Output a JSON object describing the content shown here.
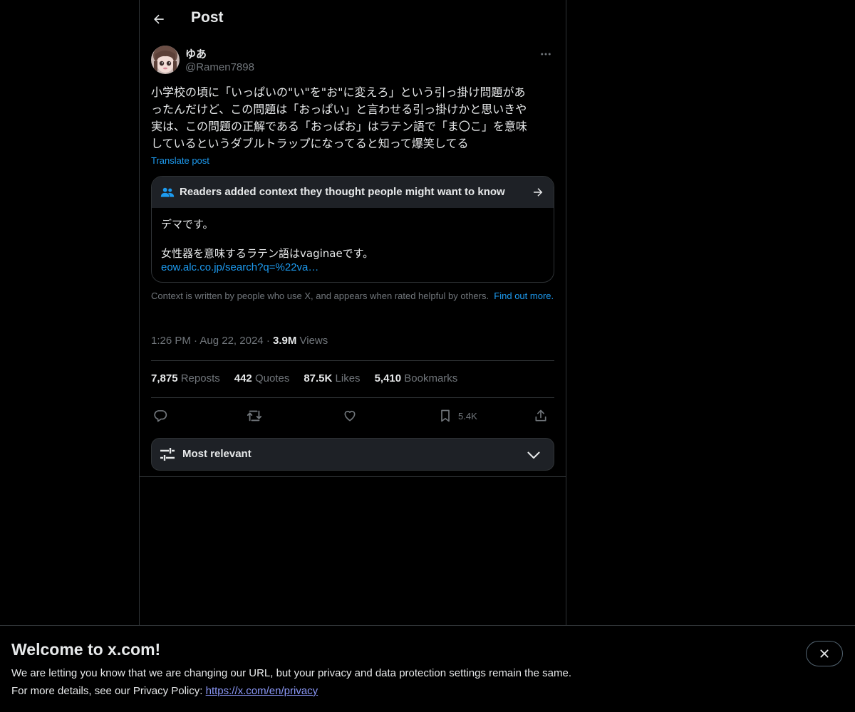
{
  "header": {
    "title": "Post",
    "back_icon": "arrow-left-icon"
  },
  "author": {
    "name": "ゆあ",
    "handle": "@Ramen7898"
  },
  "post": {
    "text": "小学校の頃に「いっぱいの\"い\"を\"お\"に変えろ」という引っ掛け問題があ\nったんだけど、この問題は「おっぱい」と言わせる引っ掛けかと思いきや\n実は、この問題の正解である「おっぱお」はラテン語で「ま〇こ」を意味\nしているというダブルトラップになってると知って爆笑してる",
    "translate_label": "Translate post"
  },
  "community_note": {
    "header": "Readers added context they thought people might want to know",
    "line1": "デマです。",
    "line2": "女性器を意味するラテン語はvaginaeです。",
    "link": "eow.alc.co.jp/search?q=%22va…",
    "disclaimer": "Context is written by people who use X, and appears when rated helpful by others.",
    "find_out": "Find out more."
  },
  "meta": {
    "time": "1:26 PM",
    "date": "Aug 22, 2024",
    "views_count": "3.9M",
    "views_label": "Views"
  },
  "stats": {
    "reposts_count": "7,875",
    "reposts_label": "Reposts",
    "quotes_count": "442",
    "quotes_label": "Quotes",
    "likes_count": "87.5K",
    "likes_label": "Likes",
    "bookmarks_count": "5,410",
    "bookmarks_label": "Bookmarks"
  },
  "actions": {
    "bookmark_count": "5.4K"
  },
  "sort": {
    "label": "Most relevant"
  },
  "banner": {
    "title": "Welcome to x.com!",
    "line1": "We are letting you know that we are changing our URL, but your privacy and data protection settings remain the same.",
    "line2_prefix": "For more details, see our Privacy Policy:",
    "link": "https://x.com/en/privacy"
  },
  "colors": {
    "background": "#000000",
    "text": "#e7e9ea",
    "muted": "#71767b",
    "accent": "#1d9bf0",
    "border": "#2f3336"
  }
}
